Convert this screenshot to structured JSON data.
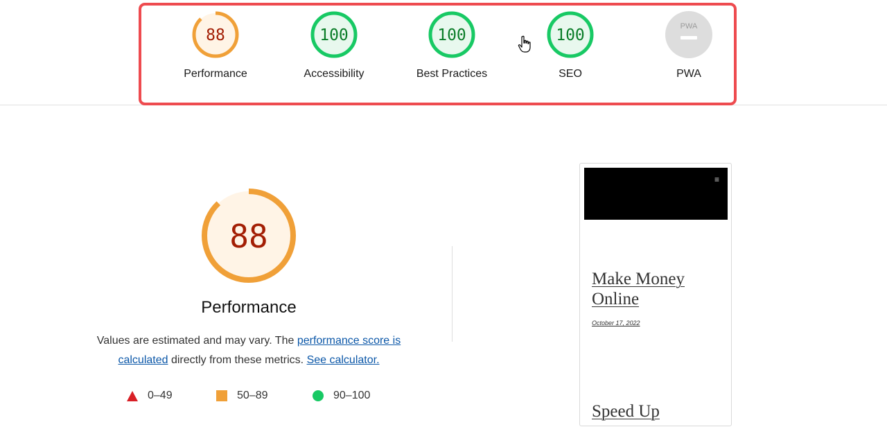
{
  "scores": [
    {
      "id": "performance",
      "label": "Performance",
      "value": "88",
      "fraction": 0.88,
      "status": "average"
    },
    {
      "id": "accessibility",
      "label": "Accessibility",
      "value": "100",
      "fraction": 1.0,
      "status": "pass"
    },
    {
      "id": "best-practices",
      "label": "Best Practices",
      "value": "100",
      "fraction": 1.0,
      "status": "pass"
    },
    {
      "id": "seo",
      "label": "SEO",
      "value": "100",
      "fraction": 1.0,
      "status": "pass"
    },
    {
      "id": "pwa",
      "label": "PWA",
      "badge": "PWA",
      "status": "na"
    }
  ],
  "colors": {
    "average_stroke": "#f0a038",
    "average_fill": "#fff4e6",
    "average_text": "#a31e04",
    "pass_stroke": "#18c964",
    "pass_fill": "#e8f8ee",
    "pass_text": "#0a7d28",
    "fail": "#d81f26",
    "na_fill": "#dddddd",
    "highlight": "#ee4b4f",
    "link": "#0b57a8"
  },
  "main": {
    "score": "88",
    "fraction": 0.88,
    "title": "Performance",
    "desc_part1": "Values are estimated and may vary. The ",
    "link_score": "performance score is calculated",
    "desc_part2": " directly from these metrics. ",
    "link_calc": "See calculator."
  },
  "legend": [
    {
      "icon": "triangle-icon",
      "range": "0–49"
    },
    {
      "icon": "square-icon",
      "range": "50–89"
    },
    {
      "icon": "circle-icon",
      "range": "90–100"
    }
  ],
  "thumbnail": {
    "menu_icon": "hamburger-icon",
    "title": "Make Money Online",
    "date": "October 17, 2022",
    "next_title": "Speed Up"
  }
}
